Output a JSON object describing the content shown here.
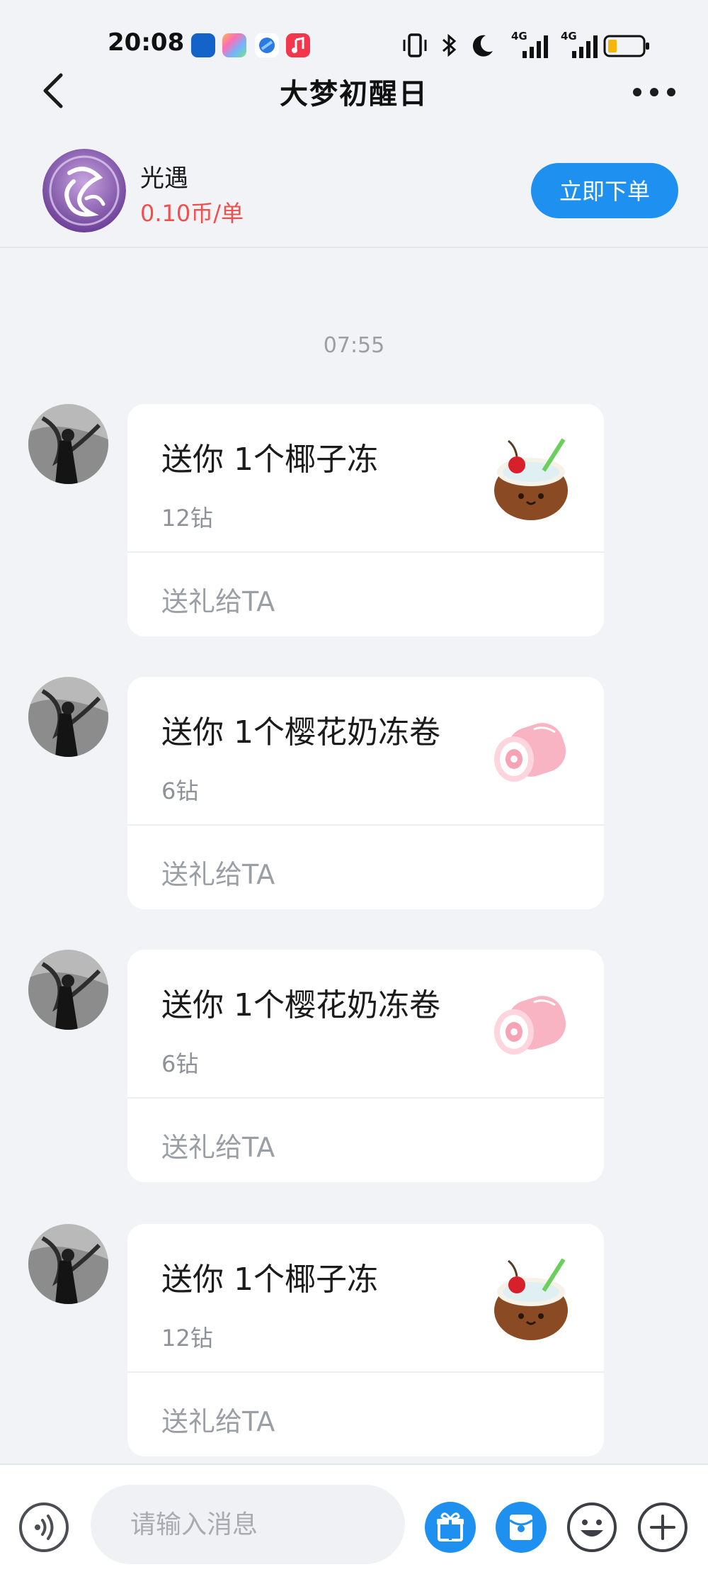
{
  "status_bar": {
    "time": "20:08",
    "network_label_1": "4G",
    "network_label_2": "4G"
  },
  "header": {
    "title": "大梦初醒日",
    "back_icon": "chevron-left-icon",
    "more_icon": "more-dots-icon"
  },
  "shop": {
    "name": "光遇",
    "price": "0.10币/单",
    "order_button": "立即下单",
    "logo_text": "光遇"
  },
  "chat": {
    "timestamp": "07:55",
    "messages": [
      {
        "title": "送你 1个椰子冻",
        "price": "12钻",
        "action": "送礼给TA",
        "gift": "coconut-jelly"
      },
      {
        "title": "送你 1个樱花奶冻卷",
        "price": "6钻",
        "action": "送礼给TA",
        "gift": "sakura-roll"
      },
      {
        "title": "送你 1个樱花奶冻卷",
        "price": "6钻",
        "action": "送礼给TA",
        "gift": "sakura-roll"
      },
      {
        "title": "送你 1个椰子冻",
        "price": "12钻",
        "action": "送礼给TA",
        "gift": "coconut-jelly"
      }
    ]
  },
  "input_bar": {
    "placeholder": "请输入消息",
    "icons": [
      "voice-icon",
      "gift-icon",
      "red-packet-icon",
      "emoji-icon",
      "plus-icon"
    ]
  },
  "colors": {
    "accent": "#1e90f0",
    "price_red": "#f0504d",
    "background": "#f1f3f7"
  }
}
